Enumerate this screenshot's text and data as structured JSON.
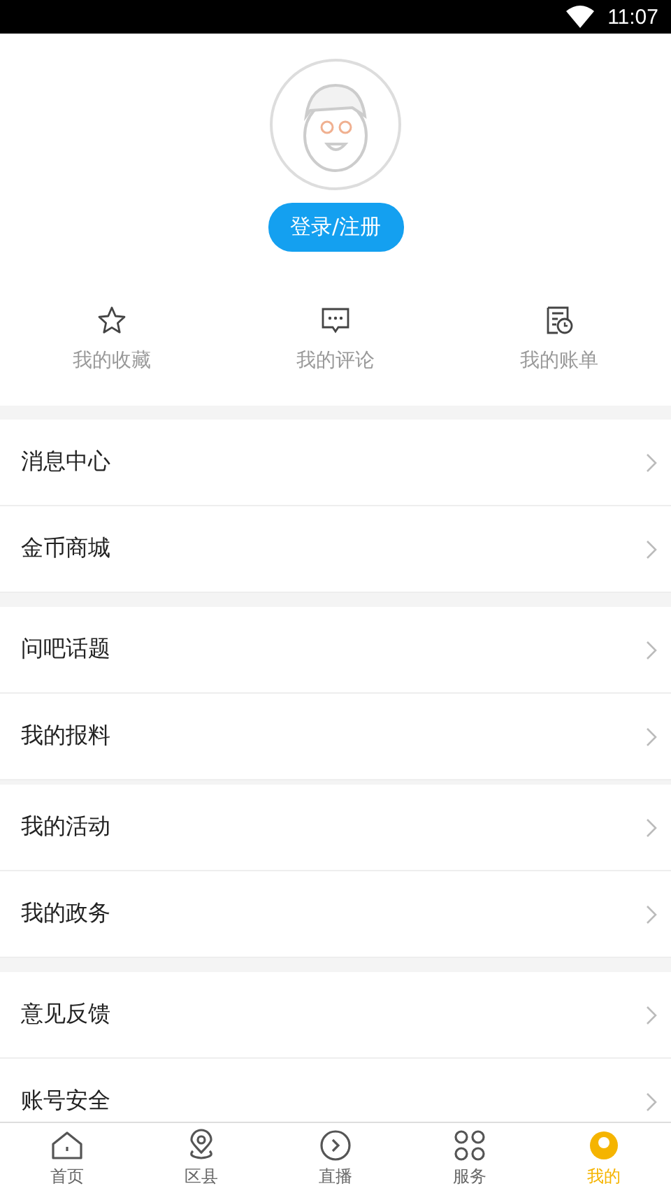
{
  "status_bar": {
    "time": "11:07"
  },
  "profile": {
    "login_button": "登录/注册"
  },
  "shortcuts": [
    {
      "label": "我的收藏",
      "kind": "star"
    },
    {
      "label": "我的评论",
      "kind": "comment"
    },
    {
      "label": "我的账单",
      "kind": "bill"
    }
  ],
  "menu_groups": [
    {
      "kind": "wide",
      "items": [
        "消息中心",
        "金币商城"
      ]
    },
    {
      "kind": "wide",
      "items": [
        "问吧话题",
        "我的报料"
      ]
    },
    {
      "kind": "thin",
      "items": [
        "我的活动",
        "我的政务"
      ]
    },
    {
      "kind": "wide",
      "items": [
        "意见反馈",
        "账号安全"
      ]
    }
  ],
  "tab_bar": [
    {
      "label": "首页",
      "kind": "home",
      "selected": false
    },
    {
      "label": "区县",
      "kind": "pin",
      "selected": false
    },
    {
      "label": "直播",
      "kind": "play",
      "selected": false
    },
    {
      "label": "服务",
      "kind": "grid",
      "selected": false
    },
    {
      "label": "我的",
      "kind": "user",
      "selected": true
    }
  ]
}
